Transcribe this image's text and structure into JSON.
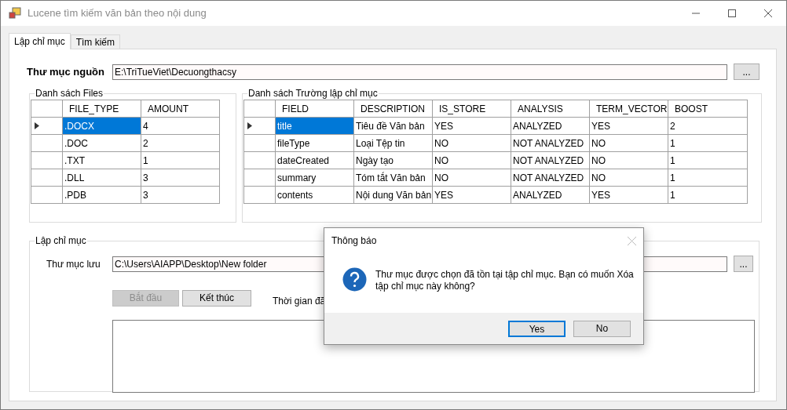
{
  "window": {
    "title": "Lucene tìm kiếm văn bản theo nội dung"
  },
  "tabs": [
    {
      "label": "Lập chỉ mục",
      "selected": true
    },
    {
      "label": "Tìm kiếm",
      "selected": false
    }
  ],
  "source_folder": {
    "label": "Thư mục nguồn",
    "value": "E:\\TriTueViet\\Decuongthacsy",
    "browse_button": "..."
  },
  "files_group": {
    "title": "Danh sách Files",
    "columns": [
      "FILE_TYPE",
      "AMOUNT"
    ],
    "rows": [
      {
        "cells": [
          ".DOCX",
          "4"
        ],
        "selected": true
      },
      {
        "cells": [
          ".DOC",
          "2"
        ],
        "selected": false
      },
      {
        "cells": [
          ".TXT",
          "1"
        ],
        "selected": false
      },
      {
        "cells": [
          ".DLL",
          "3"
        ],
        "selected": false
      },
      {
        "cells": [
          ".PDB",
          "3"
        ],
        "selected": false
      }
    ]
  },
  "fields_group": {
    "title": "Danh sách Trường lập chỉ mục",
    "columns": [
      "FIELD",
      "DESCRIPTION",
      "IS_STORE",
      "ANALYSIS",
      "TERM_VECTOR",
      "BOOST"
    ],
    "rows": [
      {
        "cells": [
          "title",
          "Tiêu đề Văn bản",
          "YES",
          "ANALYZED",
          "YES",
          "2"
        ],
        "selected": true
      },
      {
        "cells": [
          "fileType",
          "Loại Tệp tin",
          "NO",
          "NOT ANALYZED",
          "NO",
          "1"
        ],
        "selected": false
      },
      {
        "cells": [
          "dateCreated",
          "Ngày tạo",
          "NO",
          "NOT ANALYZED",
          "NO",
          "1"
        ],
        "selected": false
      },
      {
        "cells": [
          "summary",
          "Tóm tắt Văn bản",
          "NO",
          "NOT ANALYZED",
          "NO",
          "1"
        ],
        "selected": false
      },
      {
        "cells": [
          "contents",
          "Nội dung Văn bản",
          "YES",
          "ANALYZED",
          "YES",
          "1"
        ],
        "selected": false
      }
    ]
  },
  "index_group": {
    "title": "Lập chỉ mục",
    "folder_label": "Thư mục lưu",
    "folder_value": "C:\\Users\\AIAPP\\Desktop\\New folder",
    "browse_button": "...",
    "buttons": [
      {
        "label": "Bắt đầu",
        "disabled": true
      },
      {
        "label": "Kết thúc",
        "disabled": false
      }
    ],
    "elapsed_label": "Thời gian đã"
  },
  "dialog": {
    "title": "Thông báo",
    "message": "Thư mục được chọn đã tồn tại tập chỉ mục. Bạn có muốn Xóa tập chỉ mục này không?",
    "buttons": [
      {
        "label": "Yes",
        "selected": true
      },
      {
        "label": "No",
        "selected": false
      }
    ]
  }
}
